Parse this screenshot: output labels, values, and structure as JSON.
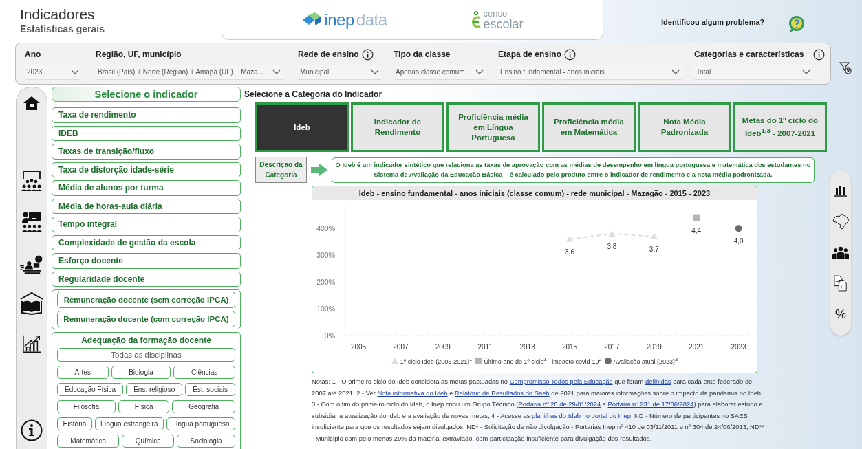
{
  "header": {
    "title": "Indicadores",
    "subtitle": "Estatísticas gerais",
    "logo_inep": {
      "strong": "inep",
      "light": "data"
    },
    "logo_censo": {
      "top": "censo",
      "bottom": "escolar"
    },
    "report_problem": "Identificou algum problema?"
  },
  "filters": [
    {
      "label": "Ano",
      "value": "2023",
      "info": false
    },
    {
      "label": "Região, UF, município",
      "value": "Brasil (País) + Norte (Região) + Amapá (UF) + Maza...",
      "info": false
    },
    {
      "label": "Rede de ensino",
      "value": "Municipal",
      "info": true
    },
    {
      "label": "Tipo da classe",
      "value": "Apenas classe comum",
      "info": false
    },
    {
      "label": "Etapa de ensino",
      "value": "Ensino fundamental - anos iniciais",
      "info": true
    },
    {
      "label": "Categorias e características",
      "value": "Total",
      "info": true
    }
  ],
  "indicators": {
    "title": "Selecione o indicador",
    "items": [
      "Taxa de rendimento",
      "IDEB",
      "Taxas de transição/fluxo",
      "Taxa de distorção idade-série",
      "Média de alunos por turma",
      "Média de horas-aula diária",
      "Tempo integral",
      "Complexidade de gestão da escola",
      "Esforço docente",
      "Regularidade docente"
    ],
    "remuneration": [
      "Remuneração docente (sem correção IPCA)",
      "Remuneração docente (com correção IPCA)"
    ],
    "formation": {
      "title": "Adequação da formação docente",
      "all": "Todas as disciplinas",
      "subjects": [
        "Artes",
        "Biologia",
        "Ciências",
        "Educação Física",
        "Ens. religioso",
        "Est. sociais",
        "Filosofia",
        "Física",
        "Geografia",
        "História",
        "Língua estrangeira",
        "Língua portuguesa",
        "Matemática",
        "Química",
        "Sociologia"
      ]
    }
  },
  "category_prompt": "Selecione a Categoria do Indicador",
  "categories": [
    {
      "label": "Ideb",
      "selected": true
    },
    {
      "label": "Indicador de Rendimento",
      "selected": false
    },
    {
      "label": "Proficiência média em Língua Portuguesa",
      "selected": false
    },
    {
      "label": "Proficiência média em Matemática",
      "selected": false
    },
    {
      "label": "Nota Média Padronizada",
      "selected": false
    },
    {
      "label": "Metas do 1º ciclo do Ideb$^{1,3}$ - 2007-2021",
      "selected": false
    }
  ],
  "description": {
    "button": "Descrição da Categoria",
    "text": "O Ideb é um indicador sintético que relaciona as taxas de aprovação com as médias de desempenho em língua portuguesa e matemática dos estudantes no Sistema de Avaliação da Educação Básica – é calculado pelo produto entre o indicador de rendimento e a nota média padronizada."
  },
  "chart": {
    "title": "Ideb - ensino fundamental - anos iniciais (classe comum) - rede municipal - Mazagão - 2015 - 2023",
    "chart_data": {
      "type": "line",
      "categories": [
        "2005",
        "2007",
        "2009",
        "2011",
        "2013",
        "2015",
        "2017",
        "2019",
        "2021",
        "2023"
      ],
      "series": [
        {
          "name": "1º ciclo Ideb (2005-2021)$^{1}$",
          "color": "#dedede",
          "line_style": "dashed",
          "marker": "triangle",
          "values": [
            null,
            null,
            null,
            null,
            null,
            3.6,
            3.8,
            3.7,
            null,
            null
          ],
          "value_labels": [
            null,
            null,
            null,
            null,
            null,
            "3,6",
            "3,8",
            "3,7",
            null,
            null
          ]
        },
        {
          "name": "Último ano do 1º ciclo$^{1}$ - impacto covid-19$^{2}$",
          "color": "#b4b4b4",
          "marker": "square",
          "values": [
            null,
            null,
            null,
            null,
            null,
            null,
            null,
            null,
            4.4,
            null
          ],
          "value_labels": [
            null,
            null,
            null,
            null,
            null,
            null,
            null,
            null,
            "4,4",
            null
          ]
        },
        {
          "name": "Avaliação atual (2023)$^{3}$",
          "color": "#6b6b6b",
          "marker": "circle",
          "values": [
            null,
            null,
            null,
            null,
            null,
            null,
            null,
            null,
            null,
            4.0
          ],
          "value_labels": [
            null,
            null,
            null,
            null,
            null,
            null,
            null,
            null,
            null,
            "4,0"
          ]
        }
      ],
      "ylim": [
        0,
        4.8
      ],
      "yticks": [
        {
          "value": 0,
          "label": "0%"
        },
        {
          "value": 1,
          "label": "100%"
        },
        {
          "value": 2,
          "label": "200%"
        },
        {
          "value": 3,
          "label": "300%"
        },
        {
          "value": 4,
          "label": "400%"
        }
      ]
    }
  },
  "notes": [
    {
      "kind": "text",
      "text": "Notas: 1 - O primeiro ciclo do Ideb considera as metas pactuadas no "
    },
    {
      "kind": "link",
      "text": "Compromisso Todos pela Educação"
    },
    {
      "kind": "text",
      "text": " que foram "
    },
    {
      "kind": "link",
      "text": "definidas"
    },
    {
      "kind": "text",
      "text": " para cada ente federado de 2007 até 2021; 2 - Ver "
    },
    {
      "kind": "link",
      "text": "Nota informativa do Ideb"
    },
    {
      "kind": "text",
      "text": " e "
    },
    {
      "kind": "link",
      "text": "Relatório de Resultados do Saeb"
    },
    {
      "kind": "text",
      "text": " de 2021 para maiores informações sobre o impacto da pandemia no Ideb; 3 - Com o fim do primeiro ciclo do Ideb, o Inep criou um Grupo Técnico ("
    },
    {
      "kind": "link",
      "text": "Portaria nº 26 de 29/01/2024"
    },
    {
      "kind": "text",
      "text": " e "
    },
    {
      "kind": "link",
      "text": "Portaria nº 231 de 17/06/2024"
    },
    {
      "kind": "text",
      "text": ") para elaborar estudo e subsidiar a atualização do Ideb e a avaliação de novas metas; 4 - Acesse as "
    },
    {
      "kind": "link",
      "text": "planilhas do Ideb no portal do Inep"
    },
    {
      "kind": "text",
      "text": "; ND - Número de participantes no SAEB insuficiente para que os resultados sejam divulgados; ND* - Solicitação de não divulgação - Portarias Inep nº 410 de 03/11/2011 e nº 304 de 24/06/2013; ND** - Município com pelo menos 20% do material extraviado, com participação insuficiente para divulgação dos resultados."
    }
  ],
  "right_toolbar": {
    "percent": "%"
  }
}
